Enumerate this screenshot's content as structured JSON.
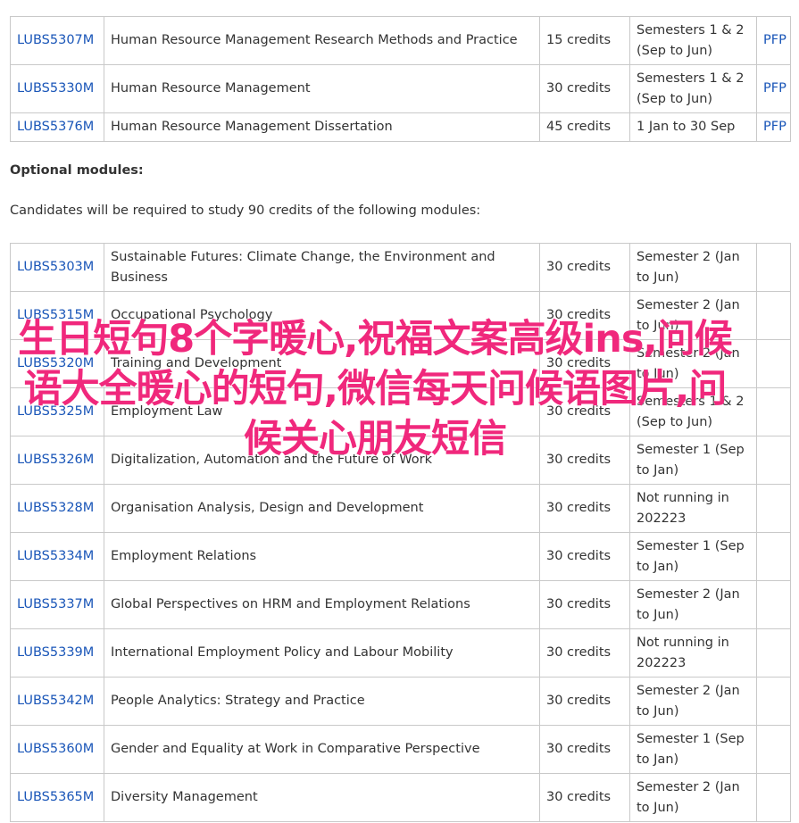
{
  "core_modules": [
    {
      "code": "LUBS5307M",
      "title": "Human Resource Management Research Methods and Practice",
      "credits": "15 credits",
      "semester": "Semesters 1 & 2 (Sep to Jun)",
      "link": "PFP"
    },
    {
      "code": "LUBS5330M",
      "title": "Human Resource Management",
      "credits": "30 credits",
      "semester": "Semesters 1 & 2 (Sep to Jun)",
      "link": "PFP"
    },
    {
      "code": "LUBS5376M",
      "title": "Human Resource Management Dissertation",
      "credits": "45 credits",
      "semester": "1 Jan to 30 Sep",
      "link": "PFP"
    }
  ],
  "optional_heading": "Optional modules:",
  "optional_intro": "Candidates will be required to study 90 credits of the following modules:",
  "optional_modules": [
    {
      "code": "LUBS5303M",
      "title": "Sustainable Futures: Climate Change, the Environment and Business",
      "credits": "30 credits",
      "semester": "Semester 2 (Jan to Jun)"
    },
    {
      "code": "LUBS5315M",
      "title": "Occupational Psychology",
      "credits": "30 credits",
      "semester": "Semester 2 (Jan to Jun)"
    },
    {
      "code": "LUBS5320M",
      "title": "Training and Development",
      "credits": "30 credits",
      "semester": "Semester 2 (Jan to Jun)"
    },
    {
      "code": "LUBS5325M",
      "title": "Employment Law",
      "credits": "30 credits",
      "semester": "Semesters 1 & 2 (Sep to Jun)"
    },
    {
      "code": "LUBS5326M",
      "title": "Digitalization, Automation and the Future of Work",
      "credits": "30 credits",
      "semester": "Semester 1 (Sep to Jan)"
    },
    {
      "code": "LUBS5328M",
      "title": "Organisation Analysis, Design and Development",
      "credits": "30 credits",
      "semester": "Not running in 202223"
    },
    {
      "code": "LUBS5334M",
      "title": "Employment Relations",
      "credits": "30 credits",
      "semester": "Semester 1 (Sep to Jan)"
    },
    {
      "code": "LUBS5337M",
      "title": "Global Perspectives on HRM and Employment Relations",
      "credits": "30 credits",
      "semester": "Semester 2 (Jan to Jun)"
    },
    {
      "code": "LUBS5339M",
      "title": "International Employment Policy and Labour Mobility",
      "credits": "30 credits",
      "semester": "Not running in 202223"
    },
    {
      "code": "LUBS5342M",
      "title": "People Analytics: Strategy and Practice",
      "credits": "30 credits",
      "semester": "Semester 2 (Jan to Jun)"
    },
    {
      "code": "LUBS5360M",
      "title": "Gender and Equality at Work in Comparative Perspective",
      "credits": "30 credits",
      "semester": "Semester 1 (Sep to Jan)"
    },
    {
      "code": "LUBS5365M",
      "title": "Diversity Management",
      "credits": "30 credits",
      "semester": "Semester 2 (Jan to Jun)"
    }
  ],
  "overlay_text": "生日短句8个字暖心,祝福文案高级ins,问候语大全暖心的短句,微信每天问候语图片,问候关心朋友短信",
  "colors": {
    "link": "#1a56b8",
    "overlay": "#f0287c",
    "border": "#c9c9c9"
  }
}
